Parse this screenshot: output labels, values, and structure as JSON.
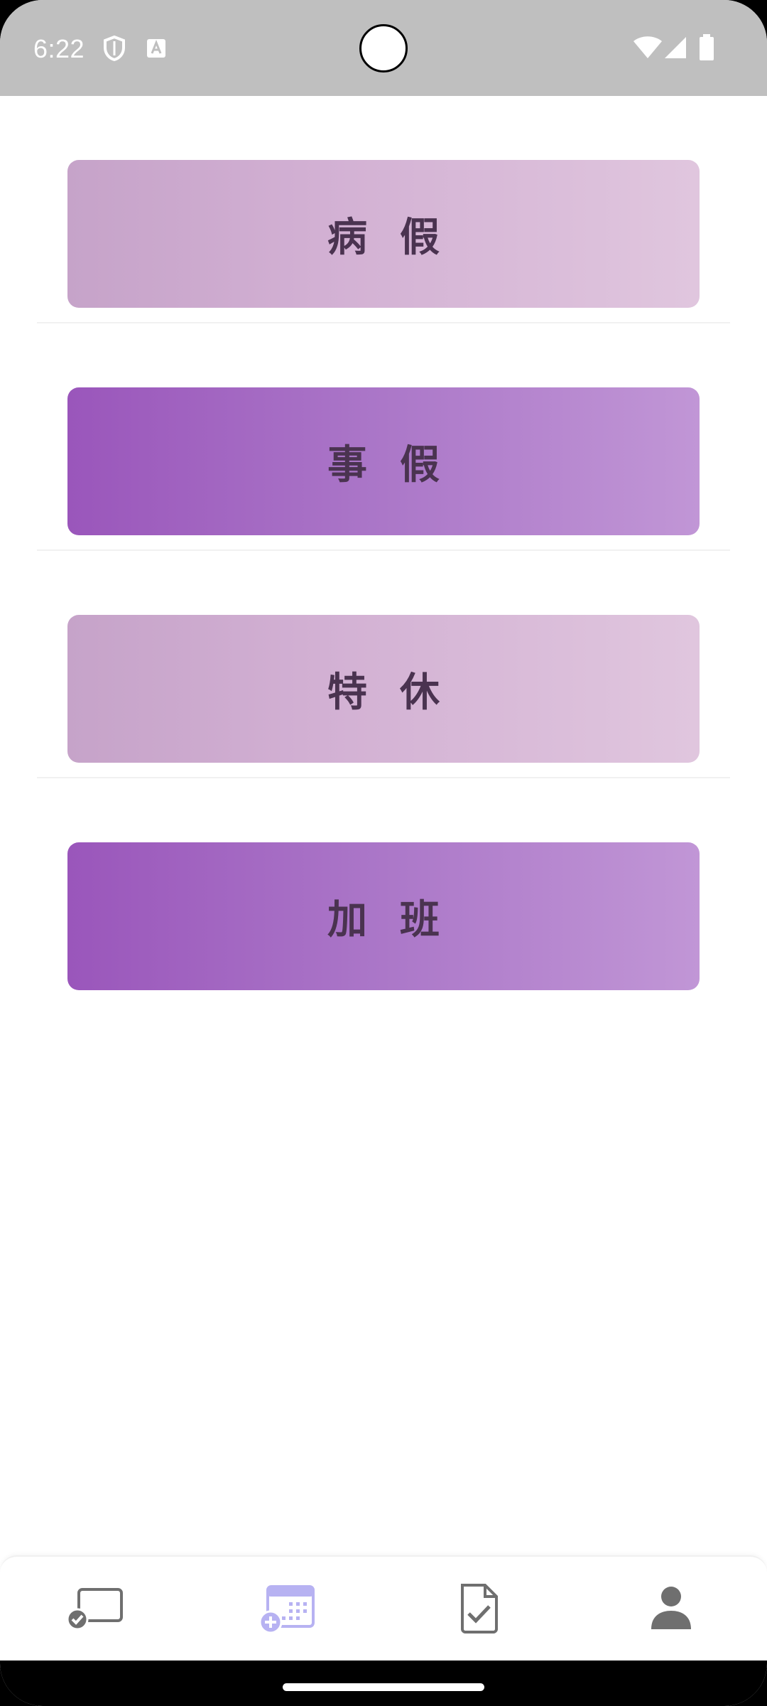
{
  "status_bar": {
    "time": "6:22",
    "icons": [
      "shield-icon",
      "text-a-icon",
      "wifi-icon",
      "signal-icon",
      "battery-icon"
    ]
  },
  "leave_types": [
    {
      "label": "病假",
      "style": "light"
    },
    {
      "label": "事假",
      "style": "dark"
    },
    {
      "label": "特休",
      "style": "light"
    },
    {
      "label": "加班",
      "style": "dark"
    }
  ],
  "bottom_nav": {
    "items": [
      {
        "name": "checkin",
        "icon": "cast-check-icon",
        "active": false
      },
      {
        "name": "apply-leave",
        "icon": "calendar-add-icon",
        "active": true
      },
      {
        "name": "approval",
        "icon": "document-check-icon",
        "active": false
      },
      {
        "name": "profile",
        "icon": "person-icon",
        "active": false
      }
    ]
  },
  "colors": {
    "status_bar": "#bfbfbf",
    "button_light_start": "#c6a3c9",
    "button_light_end": "#e0c6de",
    "button_dark_start": "#9a56bb",
    "button_dark_end": "#c196d6",
    "button_text": "#4a3350",
    "nav_active": "#b7b2f2",
    "nav_inactive": "#6f6f6f"
  }
}
